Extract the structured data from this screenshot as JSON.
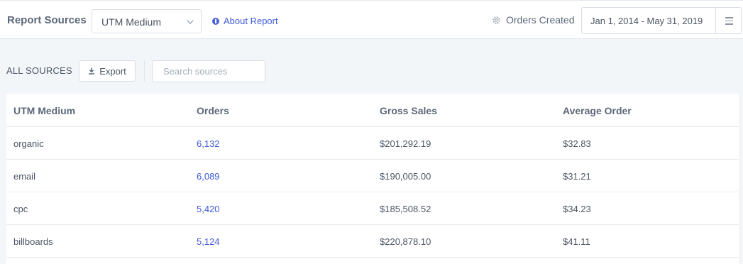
{
  "header": {
    "title": "Report Sources",
    "select_value": "UTM Medium",
    "about_label": "About Report",
    "orders_created_label": "Orders Created",
    "date_range": "Jan 1, 2014 - May 31, 2019",
    "icons": {
      "select_chevron": "chevron-down-icon",
      "about": "info-icon",
      "orders_created": "gear-icon",
      "menu": "hamburger-menu-icon"
    }
  },
  "toolbar": {
    "all_sources_label": "ALL SOURCES",
    "export_label": "Export",
    "export_icon": "download-icon",
    "search_placeholder": "Search sources"
  },
  "table": {
    "columns": [
      "UTM Medium",
      "Orders",
      "Gross Sales",
      "Average Order"
    ],
    "rows": [
      {
        "medium": "organic",
        "orders": "6,132",
        "gross_sales": "$201,292.19",
        "average_order": "$32.83"
      },
      {
        "medium": "email",
        "orders": "6,089",
        "gross_sales": "$190,005.00",
        "average_order": "$31.21"
      },
      {
        "medium": "cpc",
        "orders": "5,420",
        "gross_sales": "$185,508.52",
        "average_order": "$34.23"
      },
      {
        "medium": "billboards",
        "orders": "5,124",
        "gross_sales": "$220,878.10",
        "average_order": "$41.11"
      }
    ]
  },
  "colors": {
    "link": "#3f5bd9",
    "page_background": "#f3f6f9",
    "text": "#4b5563"
  }
}
